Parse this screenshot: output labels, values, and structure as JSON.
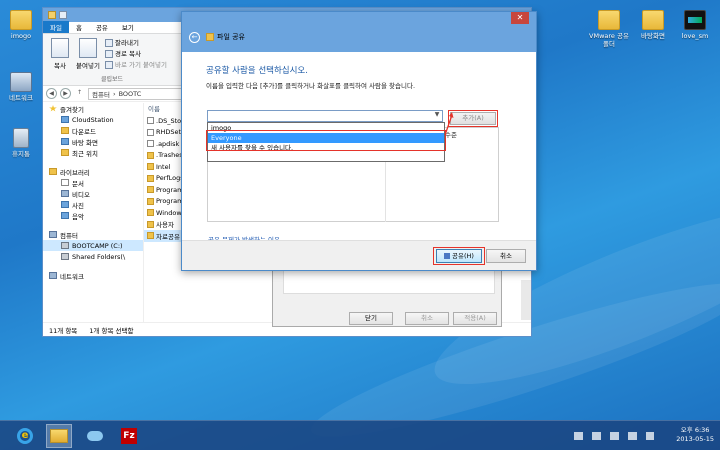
{
  "desktop": {
    "icons": [
      {
        "label": "imogo"
      },
      {
        "label": "네트워크"
      },
      {
        "label": "휴지통"
      },
      {
        "label": "VMware 공유 폴더"
      },
      {
        "label": "바탕화면"
      },
      {
        "label": "love_sm"
      }
    ]
  },
  "explorer": {
    "ribbon_tabs": [
      "파일",
      "홈",
      "공유",
      "보기"
    ],
    "ribbon": {
      "copy": "복사",
      "paste": "붙여넣기",
      "cut": "잘라내기",
      "copy_path": "경로 복사",
      "paste_shortcut": "바로 가기 붙여넣기",
      "group_label": "클립보드"
    },
    "breadcrumb": [
      "컴퓨터",
      "BOOTC"
    ],
    "nav": {
      "favorites": "즐겨찾기",
      "favorites_items": [
        "CloudStation",
        "다운로드",
        "바탕 화면",
        "최근 위치"
      ],
      "libraries": "라이브러리",
      "library_items": [
        "문서",
        "비디오",
        "사진",
        "음악"
      ],
      "computer": "컴퓨터",
      "computer_items": [
        "BOOTCAMP (C:)",
        "Shared Folders(\\"
      ],
      "network": "네트워크"
    },
    "file_column_header": "이름",
    "files": [
      ".DS_Stor",
      "RHDSet",
      ".apdisk",
      ".Trashes",
      "Intel",
      "PerfLogs",
      "Program",
      "Program",
      "Windows",
      "사용자",
      "자료공유"
    ],
    "status": {
      "count": "11개 항목",
      "selected": "1개 항목 선택함"
    }
  },
  "properties": {
    "buttons": {
      "close": "닫기",
      "cancel": "취소",
      "apply": "적용(A)"
    }
  },
  "dialog": {
    "title": "파일 공유",
    "close_glyph": "✕",
    "back_glyph": "←",
    "heading": "공유할 사람을 선택하십시오.",
    "instruction": "이름을 입력한 다음 [추가]를 클릭하거나 화살표를 클릭하여 사람을 찾습니다.",
    "add_button": "추가(A)",
    "dropdown_items": [
      "imogo",
      "Everyone",
      "새 사용자를 찾을 수 있습니다."
    ],
    "column_header_right": "수준",
    "help_link": "공유 문제가 발생하는 이유",
    "share_button": "공유(H)",
    "cancel_button": "취소"
  },
  "taskbar": {
    "ie_glyph": "e",
    "filezilla_glyph": "Fz",
    "ampm": "오후 6:36",
    "date": "2013-05-15"
  }
}
